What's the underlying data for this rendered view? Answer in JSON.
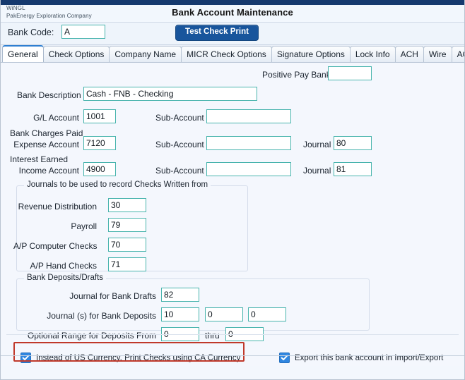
{
  "window": {
    "brand_line1": "WiNGL",
    "brand_line2": "PakEnergy Exploration Company",
    "title": "Bank Account Maintenance"
  },
  "colors": {
    "titlebar": "#15396e",
    "accent_button": "#18559c",
    "field_border": "#4bb8b0",
    "checkbox": "#2f86e0",
    "highlight_box": "#c0392b",
    "active_tab_underline": "#2f7fd1"
  },
  "toolbar": {
    "bank_code_label": "Bank Code:",
    "bank_code_value": "A",
    "test_check_print_label": "Test Check Print"
  },
  "tabs": [
    {
      "label": "General",
      "active": true
    },
    {
      "label": "Check Options",
      "active": false
    },
    {
      "label": "Company Name",
      "active": false
    },
    {
      "label": "MICR Check Options",
      "active": false
    },
    {
      "label": "Signature Options",
      "active": false
    },
    {
      "label": "Lock Info",
      "active": false
    },
    {
      "label": "ACH",
      "active": false
    },
    {
      "label": "Wire",
      "active": false
    },
    {
      "label": "ACH Upload",
      "active": false
    }
  ],
  "general": {
    "positive_pay_bank_label": "Positive Pay Bank",
    "positive_pay_bank_value": "",
    "bank_description_label": "Bank Description",
    "bank_description_value": "Cash - FNB - Checking",
    "gl_account_label": "G/L Account",
    "gl_account_value": "1001",
    "gl_sub_account_label": "Sub-Account",
    "gl_sub_account_value": "",
    "bank_charges_paid_label": "Bank Charges Paid",
    "expense_account_label": "Expense Account",
    "expense_account_value": "7120",
    "expense_sub_account_label": "Sub-Account",
    "expense_sub_account_value": "",
    "expense_journal_label": "Journal",
    "expense_journal_value": "80",
    "interest_earned_label": "Interest Earned",
    "income_account_label": "Income Account",
    "income_account_value": "4900",
    "income_sub_account_label": "Sub-Account",
    "income_sub_account_value": "",
    "income_journal_label": "Journal",
    "income_journal_value": "81"
  },
  "checks_written_group": {
    "title": "Journals to be used to record Checks Written from",
    "rows": [
      {
        "label": "Revenue Distribution",
        "value": "30"
      },
      {
        "label": "Payroll",
        "value": "79"
      },
      {
        "label": "A/P Computer Checks",
        "value": "70"
      },
      {
        "label": "A/P Hand Checks",
        "value": "71"
      }
    ]
  },
  "bank_deposits_group": {
    "title": "Bank Deposits/Drafts",
    "journal_bank_drafts_label": "Journal for Bank Drafts",
    "journal_bank_drafts_value": "82",
    "journal_bank_deposits_label": "Journal (s) for Bank Deposits",
    "journal_bank_deposits_value1": "10",
    "journal_bank_deposits_value2": "0",
    "journal_bank_deposits_value3": "0",
    "optional_range_label": "Optional Range for Deposits From",
    "optional_range_from_value": "0",
    "optional_range_thru_label": "thru",
    "optional_range_thru_value": "0"
  },
  "footer": {
    "ca_currency_label": "Instead of US Currency, Print Checks using CA Currency",
    "ca_currency_checked": true,
    "export_label": "Export this bank account in Import/Export",
    "export_checked": true
  }
}
